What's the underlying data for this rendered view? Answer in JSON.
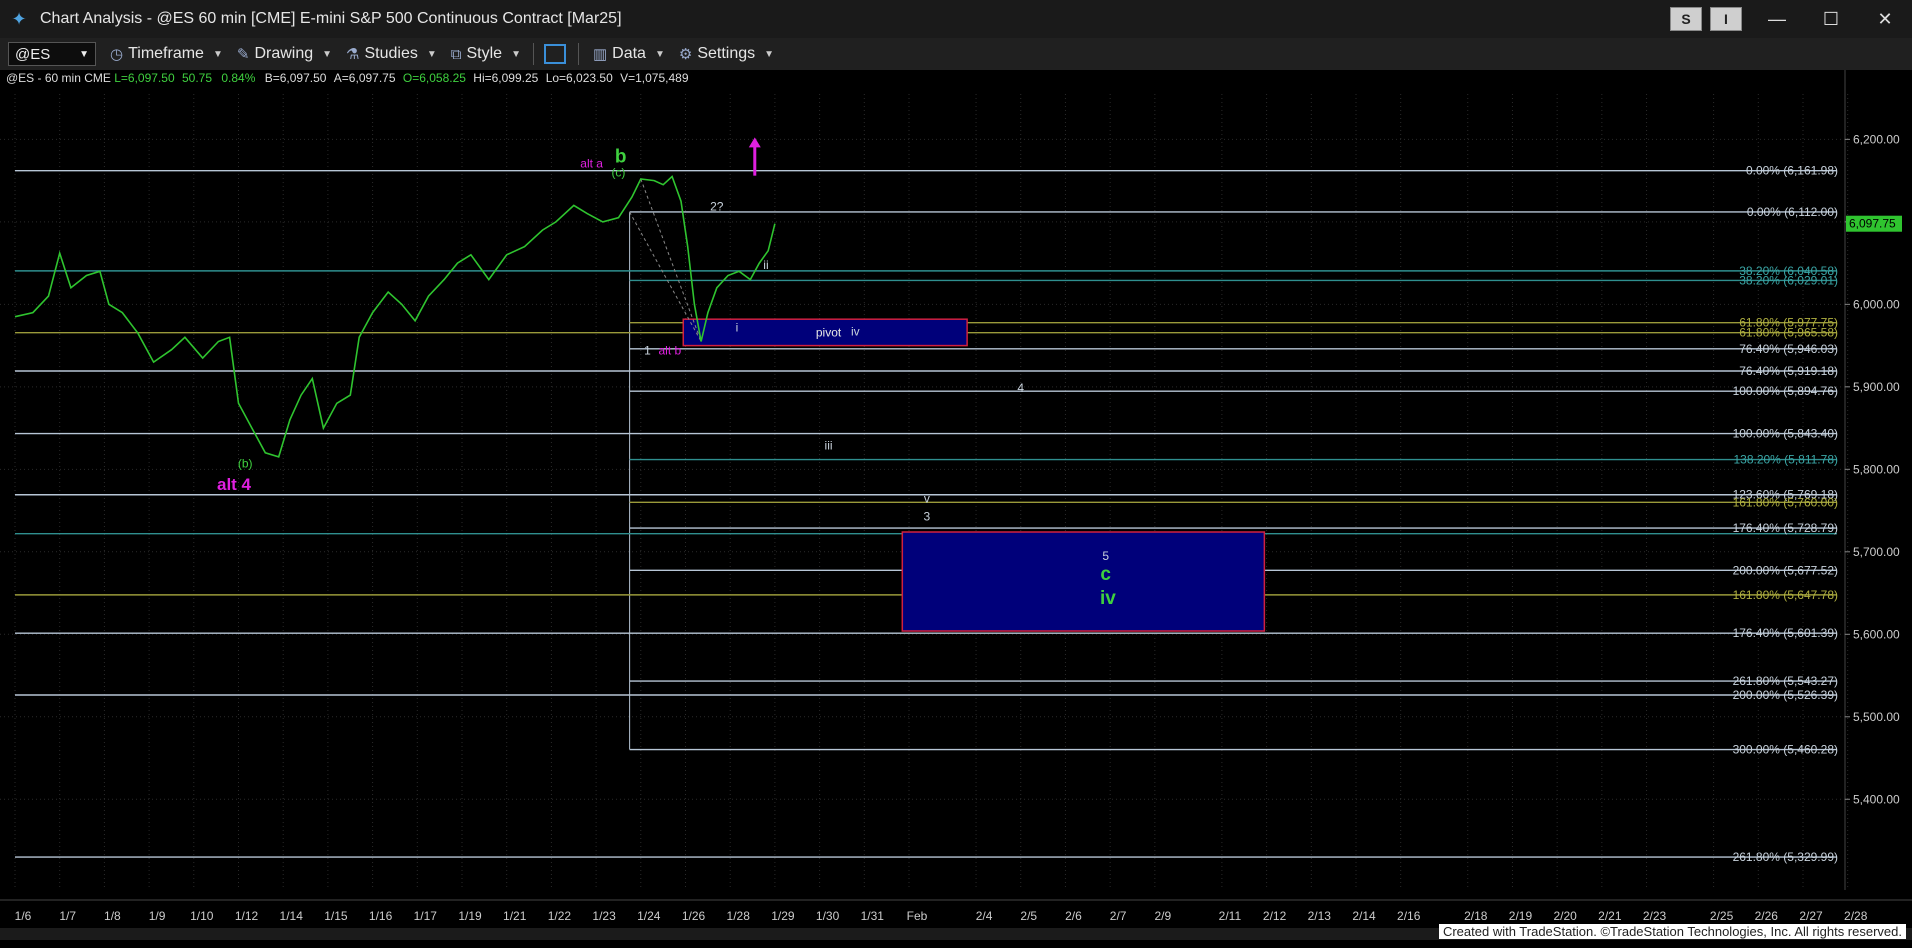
{
  "window": {
    "title": "Chart Analysis - @ES 60 min [CME] E-mini S&P 500 Continuous Contract [Mar25]"
  },
  "titlebar_buttons": {
    "s": "S",
    "i": "I",
    "minimize": "—",
    "maximize": "☐",
    "close": "✕"
  },
  "toolbar": {
    "symbol": "@ES",
    "timeframe": "Timeframe",
    "drawing": "Drawing",
    "studies": "Studies",
    "style": "Style",
    "data": "Data",
    "settings": "Settings"
  },
  "info": {
    "sym": "@ES - 60 min CME",
    "last": "L=6,097.50",
    "chg": "50.75",
    "pct": "0.84%",
    "bid": "B=6,097.50",
    "ask": "A=6,097.75",
    "open": "O=6,058.25",
    "high": "Hi=6,099.25",
    "low": "Lo=6,023.50",
    "vol": "V=1,075,489"
  },
  "credit": "Created with TradeStation. ©TradeStation Technologies, Inc. All rights reserved.",
  "chart_data": {
    "type": "line",
    "ylim": [
      5290,
      6255
    ],
    "y_ticks": [
      6200,
      6100,
      6000,
      5900,
      5800,
      5700,
      5600,
      5500,
      5400
    ],
    "y_tick_labels": [
      "6,200.00",
      "6,100.00",
      "6,000.00",
      "5,900.00",
      "5,800.00",
      "5,700.00",
      "5,600.00",
      "5,500.00",
      "5,400.00"
    ],
    "last_price": 6097.75,
    "last_price_label": "6,097.75",
    "x_labels": [
      "1/6",
      "1/7",
      "1/8",
      "1/9",
      "1/10",
      "1/12",
      "1/14",
      "1/15",
      "1/16",
      "1/17",
      "1/19",
      "1/21",
      "1/22",
      "1/23",
      "1/24",
      "1/26",
      "1/28",
      "1/29",
      "1/30",
      "1/31",
      "Feb",
      "2/4",
      "2/5",
      "2/6",
      "2/7",
      "2/9",
      "2/11",
      "2/12",
      "2/13",
      "2/14",
      "2/16",
      "2/18",
      "2/19",
      "2/20",
      "2/21",
      "2/23",
      "2/25",
      "2/26",
      "2/27",
      "2/28"
    ],
    "x_label_pos": [
      0.0,
      2.0,
      4.0,
      6.0,
      8.0,
      10.0,
      12.0,
      14.0,
      16.0,
      18.0,
      20.0,
      22.0,
      24.0,
      26.0,
      28.0,
      30.0,
      32.0,
      34.0,
      36.0,
      38.0,
      40.0,
      43.0,
      45.0,
      47.0,
      49.0,
      51.0,
      54.0,
      56.0,
      58.0,
      60.0,
      62.0,
      65.0,
      67.0,
      69.0,
      71.0,
      73.0,
      76.0,
      78.0,
      80.0,
      82.0
    ],
    "series": [
      {
        "values": [
          [
            0,
            5985
          ],
          [
            0.8,
            5990
          ],
          [
            1.5,
            6010
          ],
          [
            2,
            6062
          ],
          [
            2.5,
            6020
          ],
          [
            3.2,
            6035
          ],
          [
            3.8,
            6040
          ],
          [
            4.2,
            6000
          ],
          [
            4.8,
            5990
          ],
          [
            5.5,
            5965
          ],
          [
            6.2,
            5930
          ],
          [
            7.0,
            5945
          ],
          [
            7.6,
            5960
          ],
          [
            8.4,
            5935
          ],
          [
            9.1,
            5955
          ],
          [
            9.6,
            5960
          ],
          [
            10.0,
            5880
          ],
          [
            10.6,
            5850
          ],
          [
            11.2,
            5820
          ],
          [
            11.8,
            5815
          ],
          [
            12.3,
            5860
          ],
          [
            12.8,
            5890
          ],
          [
            13.3,
            5910
          ],
          [
            13.8,
            5850
          ],
          [
            14.4,
            5880
          ],
          [
            15.0,
            5890
          ],
          [
            15.4,
            5960
          ],
          [
            16.0,
            5990
          ],
          [
            16.7,
            6015
          ],
          [
            17.3,
            6000
          ],
          [
            17.9,
            5980
          ],
          [
            18.5,
            6010
          ],
          [
            19.2,
            6030
          ],
          [
            19.8,
            6050
          ],
          [
            20.4,
            6060
          ],
          [
            21.2,
            6030
          ],
          [
            22.0,
            6060
          ],
          [
            22.8,
            6070
          ],
          [
            23.6,
            6090
          ],
          [
            24.2,
            6100
          ],
          [
            25.0,
            6120
          ],
          [
            25.6,
            6110
          ],
          [
            26.3,
            6100
          ],
          [
            27.0,
            6105
          ],
          [
            27.6,
            6130
          ],
          [
            28.0,
            6152
          ],
          [
            28.6,
            6150
          ],
          [
            29.0,
            6145
          ],
          [
            29.4,
            6155
          ],
          [
            29.8,
            6125
          ],
          [
            30.1,
            6070
          ],
          [
            30.4,
            6000
          ],
          [
            30.7,
            5955
          ],
          [
            31.0,
            5990
          ],
          [
            31.4,
            6020
          ],
          [
            31.9,
            6035
          ],
          [
            32.4,
            6040
          ],
          [
            32.9,
            6030
          ],
          [
            33.3,
            6050
          ],
          [
            33.7,
            6065
          ],
          [
            34.0,
            6097.75
          ]
        ]
      }
    ],
    "horizontal_lines": [
      {
        "y": 6161.98,
        "x0": 0.0,
        "color": "#b7c6d6"
      },
      {
        "y": 6112.0,
        "x0": 27.5,
        "color": "#b7c6d6"
      },
      {
        "y": 6040.58,
        "x0": 0.0,
        "color": "#2f8f8f"
      },
      {
        "y": 6029.01,
        "x0": 27.5,
        "color": "#2f8f8f"
      },
      {
        "y": 5977.75,
        "x0": 27.5,
        "color": "#9a9a3a"
      },
      {
        "y": 5965.58,
        "x0": 0.0,
        "color": "#9a9a3a"
      },
      {
        "y": 5946.03,
        "x0": 27.5,
        "color": "#b7c6d6"
      },
      {
        "y": 5919.18,
        "x0": 0.0,
        "color": "#b7c6d6"
      },
      {
        "y": 5894.76,
        "x0": 27.5,
        "color": "#b7c6d6"
      },
      {
        "y": 5843.4,
        "x0": 0.0,
        "color": "#b7c6d6"
      },
      {
        "y": 5811.78,
        "x0": 27.5,
        "color": "#2f8f8f"
      },
      {
        "y": 5769.18,
        "x0": 0.0,
        "color": "#b7c6d6"
      },
      {
        "y": 5760.0,
        "x0": 27.5,
        "color": "#9a9a3a"
      },
      {
        "y": 5728.79,
        "x0": 27.5,
        "color": "#b7c6d6"
      },
      {
        "y": 5722.0,
        "x0": 0.0,
        "color": "#2f8f8f"
      },
      {
        "y": 5677.52,
        "x0": 27.5,
        "color": "#b7c6d6"
      },
      {
        "y": 5647.78,
        "x0": 0.0,
        "color": "#9a9a3a"
      },
      {
        "y": 5601.39,
        "x0": 0.0,
        "color": "#b7c6d6"
      },
      {
        "y": 5543.27,
        "x0": 27.5,
        "color": "#b7c6d6"
      },
      {
        "y": 5526.39,
        "x0": 0.0,
        "color": "#b7c6d6"
      },
      {
        "y": 5460.28,
        "x0": 27.5,
        "color": "#b7c6d6"
      },
      {
        "y": 5329.99,
        "x0": 0.0,
        "color": "#b7c6d6"
      }
    ],
    "fib_labels": [
      {
        "text": "0.00% (6,161.98)",
        "y": 6161.98,
        "color": "#c8d2dc"
      },
      {
        "text": "0.00% (6,112.00)",
        "y": 6112.0,
        "color": "#c8d2dc"
      },
      {
        "text": "38.20% (6,040.58)",
        "y": 6040.58,
        "color": "#3aa6a6"
      },
      {
        "text": "38.20% (6,029.01)",
        "y": 6029.01,
        "color": "#3aa6a6"
      },
      {
        "text": "61.80% (5,977.75)",
        "y": 5977.75,
        "color": "#b0b040"
      },
      {
        "text": "61.80% (5,965.58)",
        "y": 5965.58,
        "color": "#b0b040"
      },
      {
        "text": "76.40% (5,946.03)",
        "y": 5946.03,
        "color": "#c8d2dc"
      },
      {
        "text": "76.40% (5,919.18)",
        "y": 5919.18,
        "color": "#c8d2dc"
      },
      {
        "text": "100.00% (5,894.76)",
        "y": 5894.76,
        "color": "#c8d2dc"
      },
      {
        "text": "100.00% (5,843.40)",
        "y": 5843.4,
        "color": "#c8d2dc"
      },
      {
        "text": "138.20% (5,811.78)",
        "y": 5811.78,
        "color": "#3aa6a6"
      },
      {
        "text": "123.60% (5,769.18)",
        "y": 5769.18,
        "color": "#c8d2dc"
      },
      {
        "text": "161.80% (5,760.00)",
        "y": 5760.0,
        "color": "#b0b040"
      },
      {
        "text": "176.40% (5,728.79)",
        "y": 5728.79,
        "color": "#c8d2dc"
      },
      {
        "text": "200.00% (5,677.52)",
        "y": 5677.52,
        "color": "#c8d2dc"
      },
      {
        "text": "161.80% (5,647.78)",
        "y": 5647.78,
        "color": "#b0b040"
      },
      {
        "text": "176.40% (5,601.39)",
        "y": 5601.39,
        "color": "#c8d2dc"
      },
      {
        "text": "261.80% (5,543.27)",
        "y": 5543.27,
        "color": "#c8d2dc"
      },
      {
        "text": "200.00% (5,526.39)",
        "y": 5526.39,
        "color": "#c8d2dc"
      },
      {
        "text": "300.00% (5,460.28)",
        "y": 5460.28,
        "color": "#c8d2dc"
      },
      {
        "text": "261.80% (5,329.99)",
        "y": 5329.99,
        "color": "#c8d2dc"
      }
    ],
    "boxes": [
      {
        "x0": 29.9,
        "x1": 42.6,
        "y0": 5982,
        "y1": 5950,
        "label": "pivot",
        "label_x": 36.4,
        "label_y": 5966
      },
      {
        "x0": 39.7,
        "x1": 55.9,
        "y0": 5724,
        "y1": 5604
      }
    ],
    "annotations": [
      {
        "text": "alt a",
        "x": 25.8,
        "y": 6166,
        "color": "#e020e0",
        "size": 12
      },
      {
        "text": "b",
        "x": 27.1,
        "y": 6172,
        "color": "#3fd03f",
        "size": 19,
        "bold": true
      },
      {
        "text": "(c)",
        "x": 27.0,
        "y": 6155,
        "color": "#3fd03f",
        "size": 12
      },
      {
        "text": "2?",
        "x": 31.4,
        "y": 6114,
        "color": "#c8d2dc",
        "size": 12
      },
      {
        "text": "ii",
        "x": 33.6,
        "y": 6043,
        "color": "#c8d2dc",
        "size": 12
      },
      {
        "text": "i",
        "x": 32.3,
        "y": 5967,
        "color": "#c8d2dc",
        "size": 12
      },
      {
        "text": "iv",
        "x": 37.6,
        "y": 5962,
        "color": "#c8d2dc",
        "size": 12
      },
      {
        "text": "1",
        "x": 28.3,
        "y": 5939,
        "color": "#c8d2dc",
        "size": 12
      },
      {
        "text": "alt b",
        "x": 29.3,
        "y": 5939,
        "color": "#e020e0",
        "size": 12
      },
      {
        "text": "4",
        "x": 45.0,
        "y": 5894,
        "color": "#c8d2dc",
        "size": 12
      },
      {
        "text": "iii",
        "x": 36.4,
        "y": 5824,
        "color": "#c8d2dc",
        "size": 12
      },
      {
        "text": "(b)",
        "x": 10.3,
        "y": 5802,
        "color": "#3fd03f",
        "size": 12
      },
      {
        "text": "alt 4",
        "x": 9.8,
        "y": 5775,
        "color": "#e020e0",
        "size": 17,
        "bold": true
      },
      {
        "text": "v",
        "x": 40.8,
        "y": 5760,
        "color": "#c8d2dc",
        "size": 12
      },
      {
        "text": "3",
        "x": 40.8,
        "y": 5738,
        "color": "#c8d2dc",
        "size": 12
      },
      {
        "text": "5",
        "x": 48.8,
        "y": 5690,
        "color": "#c8d2dc",
        "size": 12
      },
      {
        "text": "c",
        "x": 48.8,
        "y": 5666,
        "color": "#3fd03f",
        "size": 19,
        "bold": true
      },
      {
        "text": "iv",
        "x": 48.9,
        "y": 5637,
        "color": "#3fd03f",
        "size": 19,
        "bold": true
      }
    ],
    "arrow": {
      "x": 33.1,
      "y_from": 6156,
      "y_to": 6200,
      "color": "#e020e0"
    }
  }
}
